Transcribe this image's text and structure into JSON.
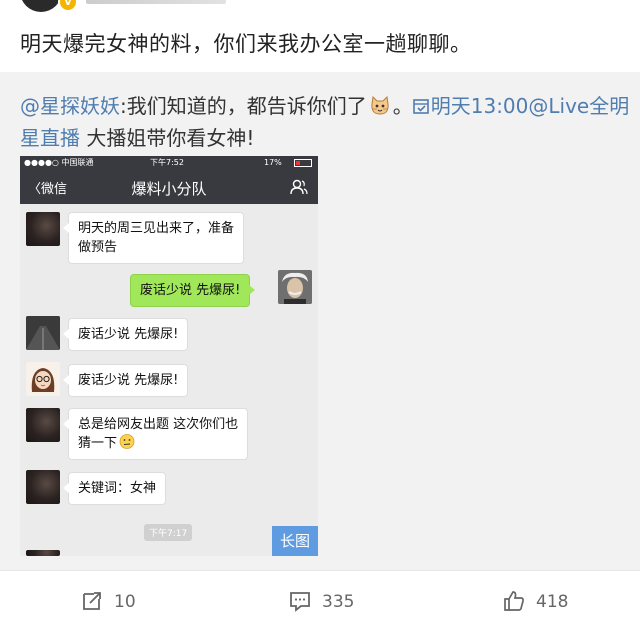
{
  "post": {
    "text": "明天爆完女神的料，你们来我办公室一趟聊聊。"
  },
  "repost": {
    "mention": "@星探妖妖",
    "text_a": ":我们知道的，都告诉你们了",
    "text_b": "。",
    "event_link": "明天13:00@Live全明星直播",
    "text_c": "  大播姐带你看女神!"
  },
  "screenshot": {
    "status": {
      "carrier": "●●●●○ 中国联通",
      "time": "下午7:52",
      "battery": "17%"
    },
    "nav": {
      "back_label": "〈微信",
      "title": "爆料小分队"
    },
    "messages": [
      {
        "side": "left",
        "avatar": "dark",
        "text_line1": "明天的周三见出来了，准备",
        "text_line2": "做预告"
      },
      {
        "side": "right",
        "avatar": "einstein",
        "text": "废话少说 先爆尿!"
      },
      {
        "side": "left",
        "avatar": "street",
        "text": "废话少说 先爆尿!"
      },
      {
        "side": "left",
        "avatar": "girl",
        "text": "废话少说 先爆尿!"
      },
      {
        "side": "left",
        "avatar": "dark",
        "text_line1": "总是给网友出题 这次你们也",
        "text_line2": "猜一下"
      },
      {
        "side": "left",
        "avatar": "dark",
        "text": "关键词：女神"
      }
    ],
    "time_chip": "下午7:17",
    "long_image_label": "长图"
  },
  "actions": {
    "repost_count": "10",
    "comment_count": "335",
    "like_count": "418"
  },
  "colors": {
    "link": "#507daf",
    "wechat_bar": "#393a3f",
    "green_bubble": "#a0e75a",
    "long_image": "#5f9be0"
  }
}
